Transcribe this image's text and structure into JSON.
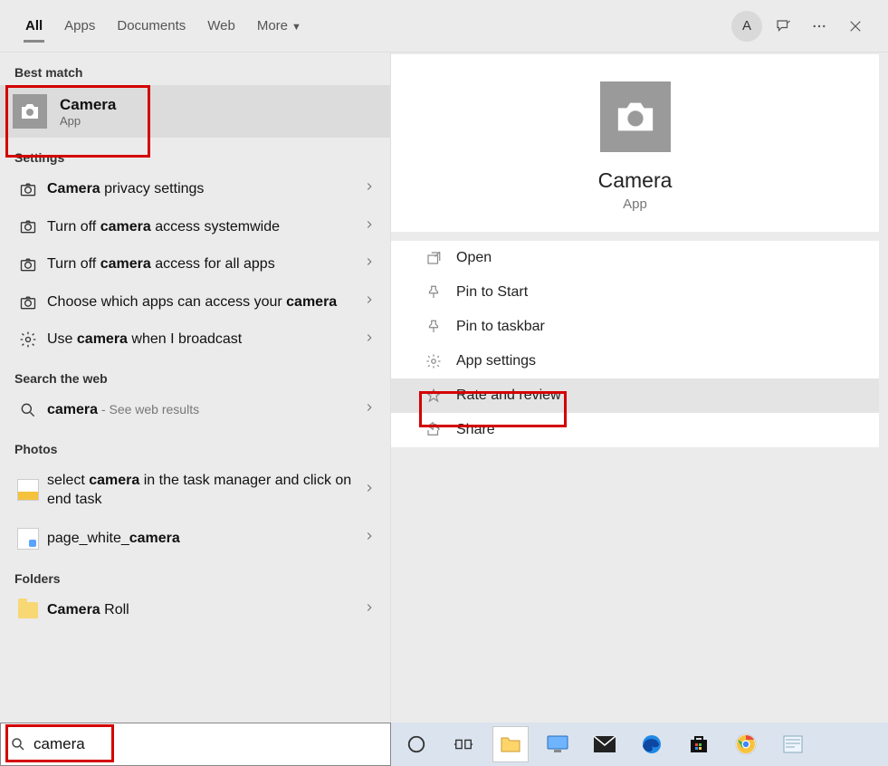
{
  "header": {
    "tabs": [
      {
        "label": "All",
        "active": true
      },
      {
        "label": "Apps"
      },
      {
        "label": "Documents"
      },
      {
        "label": "Web"
      },
      {
        "label": "More",
        "dropdown": true
      }
    ],
    "avatar_letter": "A"
  },
  "left": {
    "best_match_header": "Best match",
    "best_match": {
      "title": "Camera",
      "sub": "App"
    },
    "settings_header": "Settings",
    "settings": [
      {
        "pre": "",
        "bold": "Camera",
        "post": " privacy settings"
      },
      {
        "pre": "Turn off ",
        "bold": "camera",
        "post": " access systemwide"
      },
      {
        "pre": "Turn off ",
        "bold": "camera",
        "post": " access for all apps"
      },
      {
        "pre": "Choose which apps can access your ",
        "bold": "camera",
        "post": ""
      },
      {
        "pre": "Use ",
        "bold": "camera",
        "post": " when I broadcast",
        "icon": "gear"
      }
    ],
    "web_header": "Search the web",
    "web_item": {
      "bold": "camera",
      "hint": " - See web results"
    },
    "photos_header": "Photos",
    "photos": [
      {
        "pre": "select ",
        "bold": "camera",
        "post": " in the task manager and click on end task"
      },
      {
        "pre": "page_white_",
        "bold": "camera",
        "post": ""
      }
    ],
    "folders_header": "Folders",
    "folders": [
      {
        "bold": "Camera",
        "post": " Roll"
      }
    ]
  },
  "right": {
    "title": "Camera",
    "sub": "App",
    "actions": [
      {
        "label": "Open",
        "icon": "open"
      },
      {
        "label": "Pin to Start",
        "icon": "pin"
      },
      {
        "label": "Pin to taskbar",
        "icon": "pin"
      },
      {
        "label": "App settings",
        "icon": "gear",
        "hl": true
      },
      {
        "label": "Rate and review",
        "icon": "star",
        "hover": true
      },
      {
        "label": "Share",
        "icon": "share"
      }
    ]
  },
  "search": {
    "value": "camera"
  }
}
